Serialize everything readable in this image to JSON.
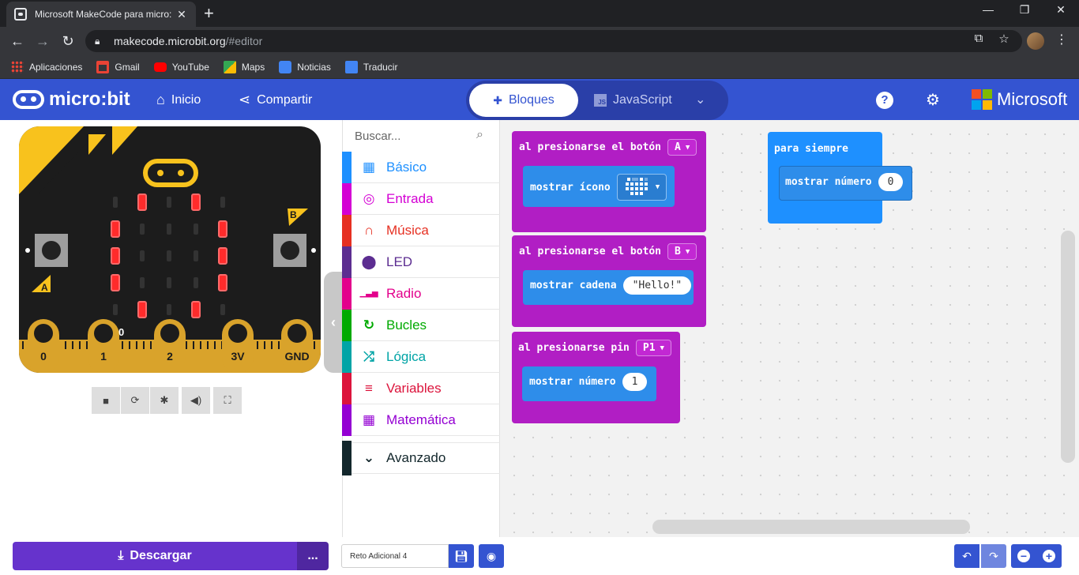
{
  "browser": {
    "tab_title": "Microsoft MakeCode para micro:",
    "url_host": "makecode.microbit.org",
    "url_path": "/#editor",
    "bookmarks": [
      {
        "label": "Aplicaciones",
        "color": "#ea4335"
      },
      {
        "label": "Gmail",
        "color": "#ea4335"
      },
      {
        "label": "YouTube",
        "color": "#ff0000"
      },
      {
        "label": "Maps",
        "color": "#34a853"
      },
      {
        "label": "Noticias",
        "color": "#4285f4"
      },
      {
        "label": "Traducir",
        "color": "#4285f4"
      }
    ]
  },
  "header": {
    "logo_text": "micro:bit",
    "home_label": "Inicio",
    "share_label": "Compartir",
    "blocks_label": "Bloques",
    "js_label": "JavaScript",
    "js_badge": "JS",
    "ms_label": "Microsoft",
    "accent": "#3454d1"
  },
  "simulator": {
    "button_a": "A",
    "button_b": "B",
    "pins": [
      "0",
      "1",
      "2",
      "3V",
      "GND"
    ],
    "pin_readout": "0",
    "led_on": [
      [
        0,
        1,
        0,
        1,
        0
      ],
      [
        1,
        0,
        0,
        0,
        1
      ],
      [
        1,
        0,
        0,
        0,
        1
      ],
      [
        1,
        0,
        0,
        0,
        1
      ],
      [
        0,
        1,
        0,
        1,
        0
      ]
    ]
  },
  "toolbox": {
    "search_placeholder": "Buscar...",
    "categories": [
      {
        "label": "Básico",
        "color": "#1e90ff",
        "icon": "grid-icon"
      },
      {
        "label": "Entrada",
        "color": "#d400d4",
        "icon": "target-icon"
      },
      {
        "label": "Música",
        "color": "#e63022",
        "icon": "headphones-icon"
      },
      {
        "label": "LED",
        "color": "#5c2d91",
        "icon": "toggle-icon"
      },
      {
        "label": "Radio",
        "color": "#e3008c",
        "icon": "signal-icon"
      },
      {
        "label": "Bucles",
        "color": "#00aa00",
        "icon": "loop-icon"
      },
      {
        "label": "Lógica",
        "color": "#00a4a6",
        "icon": "shuffle-icon"
      },
      {
        "label": "Variables",
        "color": "#dc143c",
        "icon": "lines-icon"
      },
      {
        "label": "Matemática",
        "color": "#9400d3",
        "icon": "calculator-icon"
      }
    ],
    "advanced_label": "Avanzado",
    "advanced_color": "#13272c"
  },
  "workspace": {
    "block_a": {
      "event": "al presionarse el botón",
      "button": "A",
      "inner": "mostrar ícono"
    },
    "block_b": {
      "event": "al presionarse el botón",
      "button": "B",
      "inner": "mostrar cadena",
      "value": "\"Hello!\""
    },
    "block_pin": {
      "event": "al presionarse pin",
      "pin": "P1",
      "inner": "mostrar número",
      "value": "1"
    },
    "block_forever": {
      "event": "para siempre",
      "inner": "mostrar número",
      "value": "0"
    }
  },
  "bottom": {
    "download_label": "Descargar",
    "more_label": "...",
    "project_name": "Reto Adicional 4"
  }
}
